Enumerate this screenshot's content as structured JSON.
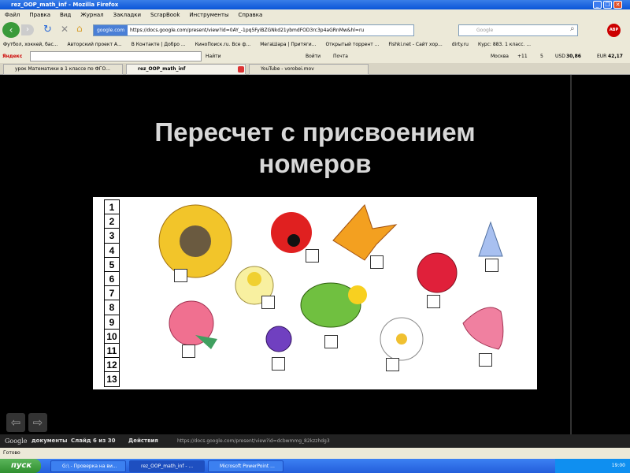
{
  "window": {
    "title": "rez_OOP_math_inf - Mozilla Firefox"
  },
  "menu": [
    "Файл",
    "Правка",
    "Вид",
    "Журнал",
    "Закладки",
    "ScrapBook",
    "Инструменты",
    "Справка"
  ],
  "nav": {
    "site_label": "google.com",
    "url": "https://docs.google.com/present/view?id=0AY_-1pq5FyiBZGNkd21ybmdFOD3rc3p4aGRnMw&hl=ru",
    "search_placeholder": "Google"
  },
  "bookmarks": [
    "Футбол, хоккей, бас...",
    "Авторский проект А...",
    "В Контакте | Добро ...",
    "КиноПоиск.ru. Все ф...",
    "МегаШара | Притяги...",
    "Открытый торрент ...",
    "Fishki.net - Сайт хор...",
    "dirty.ru",
    "Курс: 883. 1 класс. ..."
  ],
  "yandex": {
    "logo": "Яндекс",
    "find": "Найти",
    "login": "Войти",
    "mail": "Почта",
    "city": "Москва",
    "temp": "+11",
    "score": "5",
    "usd_label": "USD",
    "usd": "30,86",
    "eur_label": "EUR",
    "eur": "42,17"
  },
  "tabs": [
    "урок Математики в 1 классе по ФГО...",
    "rez_OOP_math_inf",
    "YouTube - vorobei.mov"
  ],
  "slide": {
    "title_line1": "Пересчет с присвоением",
    "title_line2": "номеров",
    "numbers": [
      "1",
      "2",
      "3",
      "4",
      "5",
      "6",
      "7",
      "8",
      "9",
      "10",
      "11",
      "12",
      "13"
    ]
  },
  "docs": {
    "logo": "Google",
    "logo_suffix": "документы",
    "slide_counter": "Слайд 6 из 30",
    "actions": "Действия",
    "url": "https://docs.google.com/present/view?id=dcbwmmg_82kzzhdg3"
  },
  "status": "Готово",
  "taskbar": {
    "start": "пуск",
    "tasks": [
      "G:\\ - Проверка на ви...",
      "rez_OOP_math_inf - ...",
      "Microsoft PowerPoint ..."
    ],
    "clock": "19:00"
  }
}
